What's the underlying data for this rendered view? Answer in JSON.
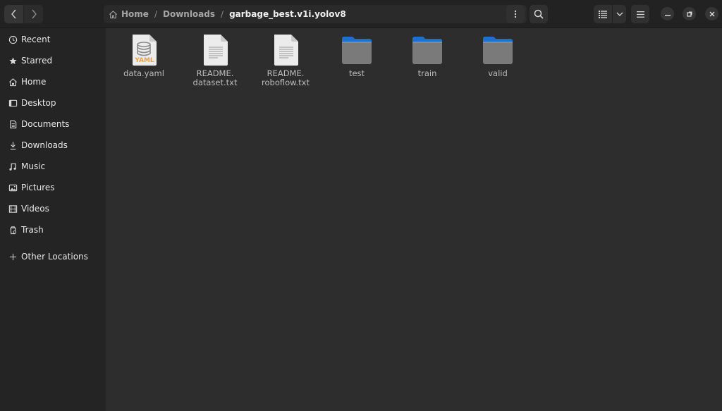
{
  "header": {
    "back_label": "Back",
    "forward_label": "Forward",
    "breadcrumb": [
      {
        "label": "Home",
        "icon": "home-icon"
      },
      {
        "label": "Downloads"
      },
      {
        "label": "garbage_best.v1i.yolov8",
        "current": true
      }
    ],
    "separator": "/",
    "buttons": {
      "menu": "more-options-icon",
      "search": "search-icon",
      "view": "list-view-icon",
      "view_dropdown": "chevron-down-icon",
      "main_menu": "hamburger-menu-icon",
      "minimize": "minimize-icon",
      "maximize": "maximize-icon",
      "close": "close-icon"
    }
  },
  "sidebar": {
    "items": [
      {
        "label": "Recent",
        "icon": "clock-icon"
      },
      {
        "label": "Starred",
        "icon": "star-icon"
      },
      {
        "label": "Home",
        "icon": "home-icon"
      },
      {
        "label": "Desktop",
        "icon": "desktop-icon"
      },
      {
        "label": "Documents",
        "icon": "document-icon"
      },
      {
        "label": "Downloads",
        "icon": "download-icon"
      },
      {
        "label": "Music",
        "icon": "music-icon"
      },
      {
        "label": "Pictures",
        "icon": "picture-icon"
      },
      {
        "label": "Videos",
        "icon": "video-icon"
      },
      {
        "label": "Trash",
        "icon": "trash-icon"
      },
      {
        "label": "Other Locations",
        "icon": "plus-icon"
      }
    ]
  },
  "files": [
    {
      "name": "data.yaml",
      "type": "yaml",
      "badge": "YAML"
    },
    {
      "name": "README.\ndataset.txt",
      "type": "text"
    },
    {
      "name": "README.\nroboflow.txt",
      "type": "text"
    },
    {
      "name": "test",
      "type": "folder"
    },
    {
      "name": "train",
      "type": "folder"
    },
    {
      "name": "valid",
      "type": "folder"
    }
  ],
  "colors": {
    "folder_tab": "#1f6fd0",
    "folder_body": "#7a7a7a",
    "yaml_badge": "#e8a33a",
    "accent": "#3584e4"
  }
}
